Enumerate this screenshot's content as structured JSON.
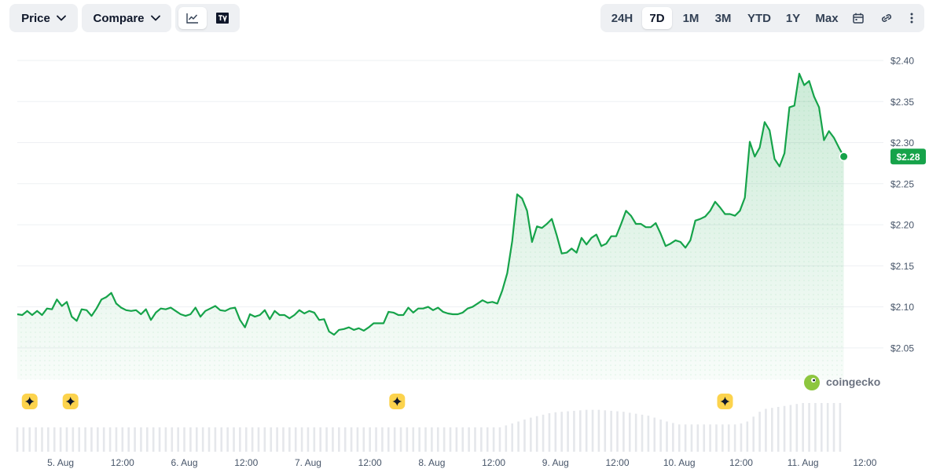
{
  "toolbar": {
    "price_label": "Price",
    "compare_label": "Compare",
    "ranges": [
      "24H",
      "7D",
      "1M",
      "3M",
      "YTD",
      "1Y",
      "Max"
    ],
    "active_range": "7D"
  },
  "watermark": "coingecko",
  "colors": {
    "line": "#16a34a",
    "badge": "#16a34a",
    "grid": "#eef0f3",
    "volume": "#e5e7eb",
    "event": "#fcd34d"
  },
  "icons": [
    "chevron-down-icon",
    "line-chart-icon",
    "tradingview-icon",
    "calendar-icon",
    "link-icon",
    "more-vertical-icon",
    "star-event-icon"
  ],
  "chart_data": {
    "type": "area",
    "y_ticks": [
      "$2.40",
      "$2.35",
      "$2.30",
      "$2.25",
      "$2.20",
      "$2.15",
      "$2.10",
      "$2.05"
    ],
    "y_tick_values": [
      2.4,
      2.35,
      2.3,
      2.25,
      2.2,
      2.15,
      2.1,
      2.05
    ],
    "ylim": [
      2.0116,
      2.4067
    ],
    "xlim": [
      0,
      7.0
    ],
    "x_ticks": [
      "5. Aug",
      "12:00",
      "6. Aug",
      "12:00",
      "7. Aug",
      "12:00",
      "8. Aug",
      "12:00",
      "9. Aug",
      "12:00",
      "10. Aug",
      "12:00",
      "11. Aug",
      "12:00"
    ],
    "x_tick_values": [
      0.35,
      0.85,
      1.35,
      1.85,
      2.35,
      2.85,
      3.35,
      3.85,
      4.35,
      4.85,
      5.35,
      5.85,
      6.35,
      6.85
    ],
    "current_price_label": "$2.28",
    "grid": true,
    "series": [
      {
        "values": [
          [
            0.0,
            2.091
          ],
          [
            0.04,
            2.09
          ],
          [
            0.08,
            2.095
          ],
          [
            0.12,
            2.09
          ],
          [
            0.16,
            2.095
          ],
          [
            0.2,
            2.09
          ],
          [
            0.24,
            2.098
          ],
          [
            0.28,
            2.097
          ],
          [
            0.32,
            2.109
          ],
          [
            0.36,
            2.101
          ],
          [
            0.4,
            2.106
          ],
          [
            0.44,
            2.088
          ],
          [
            0.48,
            2.083
          ],
          [
            0.52,
            2.097
          ],
          [
            0.56,
            2.096
          ],
          [
            0.6,
            2.089
          ],
          [
            0.64,
            2.098
          ],
          [
            0.68,
            2.109
          ],
          [
            0.72,
            2.112
          ],
          [
            0.76,
            2.117
          ],
          [
            0.8,
            2.104
          ],
          [
            0.84,
            2.099
          ],
          [
            0.88,
            2.096
          ],
          [
            0.92,
            2.095
          ],
          [
            0.96,
            2.096
          ],
          [
            1.0,
            2.091
          ],
          [
            1.04,
            2.097
          ],
          [
            1.08,
            2.084
          ],
          [
            1.12,
            2.093
          ],
          [
            1.16,
            2.098
          ],
          [
            1.2,
            2.097
          ],
          [
            1.24,
            2.099
          ],
          [
            1.28,
            2.095
          ],
          [
            1.32,
            2.091
          ],
          [
            1.36,
            2.089
          ],
          [
            1.4,
            2.091
          ],
          [
            1.44,
            2.099
          ],
          [
            1.48,
            2.088
          ],
          [
            1.52,
            2.095
          ],
          [
            1.56,
            2.098
          ],
          [
            1.6,
            2.101
          ],
          [
            1.64,
            2.096
          ],
          [
            1.68,
            2.095
          ],
          [
            1.72,
            2.098
          ],
          [
            1.76,
            2.099
          ],
          [
            1.8,
            2.084
          ],
          [
            1.84,
            2.075
          ],
          [
            1.88,
            2.091
          ],
          [
            1.92,
            2.088
          ],
          [
            1.96,
            2.09
          ],
          [
            2.0,
            2.096
          ],
          [
            2.04,
            2.085
          ],
          [
            2.08,
            2.095
          ],
          [
            2.12,
            2.09
          ],
          [
            2.16,
            2.09
          ],
          [
            2.2,
            2.086
          ],
          [
            2.24,
            2.09
          ],
          [
            2.28,
            2.096
          ],
          [
            2.32,
            2.092
          ],
          [
            2.36,
            2.095
          ],
          [
            2.4,
            2.093
          ],
          [
            2.44,
            2.084
          ],
          [
            2.48,
            2.085
          ],
          [
            2.52,
            2.07
          ],
          [
            2.56,
            2.066
          ],
          [
            2.6,
            2.072
          ],
          [
            2.64,
            2.073
          ],
          [
            2.68,
            2.075
          ],
          [
            2.72,
            2.072
          ],
          [
            2.76,
            2.074
          ],
          [
            2.8,
            2.071
          ],
          [
            2.84,
            2.075
          ],
          [
            2.88,
            2.08
          ],
          [
            2.92,
            2.08
          ],
          [
            2.96,
            2.08
          ],
          [
            3.0,
            2.094
          ],
          [
            3.04,
            2.093
          ],
          [
            3.08,
            2.09
          ],
          [
            3.12,
            2.09
          ],
          [
            3.16,
            2.099
          ],
          [
            3.2,
            2.093
          ],
          [
            3.24,
            2.098
          ],
          [
            3.28,
            2.098
          ],
          [
            3.32,
            2.1
          ],
          [
            3.36,
            2.096
          ],
          [
            3.4,
            2.099
          ],
          [
            3.44,
            2.094
          ],
          [
            3.48,
            2.092
          ],
          [
            3.52,
            2.091
          ],
          [
            3.56,
            2.091
          ],
          [
            3.6,
            2.093
          ],
          [
            3.64,
            2.098
          ],
          [
            3.68,
            2.1
          ],
          [
            3.72,
            2.104
          ],
          [
            3.76,
            2.108
          ],
          [
            3.8,
            2.105
          ],
          [
            3.84,
            2.106
          ],
          [
            3.88,
            2.104
          ],
          [
            3.92,
            2.12
          ],
          [
            3.96,
            2.141
          ],
          [
            4.0,
            2.18
          ],
          [
            4.04,
            2.237
          ],
          [
            4.08,
            2.232
          ],
          [
            4.12,
            2.217
          ],
          [
            4.16,
            2.179
          ],
          [
            4.2,
            2.198
          ],
          [
            4.24,
            2.196
          ],
          [
            4.28,
            2.201
          ],
          [
            4.32,
            2.207
          ],
          [
            4.36,
            2.187
          ],
          [
            4.4,
            2.165
          ],
          [
            4.44,
            2.166
          ],
          [
            4.48,
            2.171
          ],
          [
            4.52,
            2.166
          ],
          [
            4.56,
            2.184
          ],
          [
            4.6,
            2.176
          ],
          [
            4.64,
            2.184
          ],
          [
            4.68,
            2.188
          ],
          [
            4.72,
            2.174
          ],
          [
            4.76,
            2.177
          ],
          [
            4.8,
            2.186
          ],
          [
            4.84,
            2.186
          ],
          [
            4.88,
            2.201
          ],
          [
            4.92,
            2.217
          ],
          [
            4.96,
            2.211
          ],
          [
            5.0,
            2.201
          ],
          [
            5.04,
            2.201
          ],
          [
            5.08,
            2.197
          ],
          [
            5.12,
            2.197
          ],
          [
            5.16,
            2.202
          ],
          [
            5.2,
            2.189
          ],
          [
            5.24,
            2.174
          ],
          [
            5.28,
            2.177
          ],
          [
            5.32,
            2.181
          ],
          [
            5.36,
            2.179
          ],
          [
            5.4,
            2.172
          ],
          [
            5.44,
            2.181
          ],
          [
            5.48,
            2.205
          ],
          [
            5.52,
            2.207
          ],
          [
            5.56,
            2.21
          ],
          [
            5.6,
            2.217
          ],
          [
            5.64,
            2.228
          ],
          [
            5.68,
            2.221
          ],
          [
            5.72,
            2.213
          ],
          [
            5.76,
            2.213
          ],
          [
            5.8,
            2.211
          ],
          [
            5.84,
            2.217
          ],
          [
            5.88,
            2.233
          ],
          [
            5.92,
            2.301
          ],
          [
            5.96,
            2.283
          ],
          [
            6.0,
            2.294
          ],
          [
            6.04,
            2.325
          ],
          [
            6.08,
            2.315
          ],
          [
            6.12,
            2.28
          ],
          [
            6.16,
            2.271
          ],
          [
            6.2,
            2.287
          ],
          [
            6.24,
            2.343
          ],
          [
            6.28,
            2.345
          ],
          [
            6.32,
            2.384
          ],
          [
            6.36,
            2.37
          ],
          [
            6.4,
            2.375
          ],
          [
            6.44,
            2.356
          ],
          [
            6.48,
            2.343
          ],
          [
            6.52,
            2.303
          ],
          [
            6.56,
            2.314
          ],
          [
            6.6,
            2.306
          ],
          [
            6.64,
            2.294
          ],
          [
            6.68,
            2.283
          ]
        ]
      }
    ],
    "volume": [
      [
        0.0,
        0.5
      ],
      [
        0.05,
        0.5
      ],
      [
        0.1,
        0.5
      ],
      [
        0.15,
        0.5
      ],
      [
        0.2,
        0.5
      ],
      [
        0.25,
        0.5
      ],
      [
        0.3,
        0.5
      ],
      [
        0.35,
        0.5
      ],
      [
        0.4,
        0.5
      ],
      [
        0.45,
        0.5
      ],
      [
        0.5,
        0.5
      ],
      [
        0.55,
        0.5
      ],
      [
        0.6,
        0.5
      ],
      [
        0.65,
        0.5
      ],
      [
        0.7,
        0.5
      ],
      [
        0.75,
        0.5
      ],
      [
        0.8,
        0.5
      ],
      [
        0.85,
        0.5
      ],
      [
        0.9,
        0.5
      ],
      [
        0.95,
        0.5
      ],
      [
        1.0,
        0.5
      ],
      [
        1.05,
        0.5
      ],
      [
        1.1,
        0.5
      ],
      [
        1.15,
        0.5
      ],
      [
        1.2,
        0.5
      ],
      [
        1.25,
        0.5
      ],
      [
        1.3,
        0.5
      ],
      [
        1.35,
        0.5
      ],
      [
        1.4,
        0.5
      ],
      [
        1.45,
        0.5
      ],
      [
        1.5,
        0.5
      ],
      [
        1.55,
        0.5
      ],
      [
        1.6,
        0.5
      ],
      [
        1.65,
        0.5
      ],
      [
        1.7,
        0.5
      ],
      [
        1.75,
        0.5
      ],
      [
        1.8,
        0.5
      ],
      [
        1.85,
        0.5
      ],
      [
        1.9,
        0.5
      ],
      [
        1.95,
        0.5
      ],
      [
        2.0,
        0.5
      ],
      [
        2.05,
        0.5
      ],
      [
        2.1,
        0.5
      ],
      [
        2.15,
        0.5
      ],
      [
        2.2,
        0.5
      ],
      [
        2.25,
        0.5
      ],
      [
        2.3,
        0.5
      ],
      [
        2.35,
        0.5
      ],
      [
        2.4,
        0.5
      ],
      [
        2.45,
        0.5
      ],
      [
        2.5,
        0.5
      ],
      [
        2.55,
        0.5
      ],
      [
        2.6,
        0.5
      ],
      [
        2.65,
        0.5
      ],
      [
        2.7,
        0.5
      ],
      [
        2.75,
        0.5
      ],
      [
        2.8,
        0.5
      ],
      [
        2.85,
        0.5
      ],
      [
        2.9,
        0.5
      ],
      [
        2.95,
        0.5
      ],
      [
        3.0,
        0.5
      ],
      [
        3.05,
        0.5
      ],
      [
        3.1,
        0.5
      ],
      [
        3.15,
        0.5
      ],
      [
        3.2,
        0.5
      ],
      [
        3.25,
        0.5
      ],
      [
        3.3,
        0.5
      ],
      [
        3.35,
        0.5
      ],
      [
        3.4,
        0.5
      ],
      [
        3.45,
        0.5
      ],
      [
        3.5,
        0.5
      ],
      [
        3.55,
        0.5
      ],
      [
        3.6,
        0.5
      ],
      [
        3.65,
        0.5
      ],
      [
        3.7,
        0.5
      ],
      [
        3.75,
        0.5
      ],
      [
        3.8,
        0.5
      ],
      [
        3.85,
        0.5
      ],
      [
        3.9,
        0.5
      ],
      [
        3.95,
        0.54
      ],
      [
        4.0,
        0.58
      ],
      [
        4.05,
        0.62
      ],
      [
        4.1,
        0.66
      ],
      [
        4.15,
        0.7
      ],
      [
        4.2,
        0.73
      ],
      [
        4.25,
        0.76
      ],
      [
        4.3,
        0.79
      ],
      [
        4.35,
        0.81
      ],
      [
        4.4,
        0.82
      ],
      [
        4.45,
        0.83
      ],
      [
        4.5,
        0.84
      ],
      [
        4.55,
        0.85
      ],
      [
        4.6,
        0.86
      ],
      [
        4.65,
        0.86
      ],
      [
        4.7,
        0.86
      ],
      [
        4.75,
        0.85
      ],
      [
        4.8,
        0.84
      ],
      [
        4.85,
        0.83
      ],
      [
        4.9,
        0.82
      ],
      [
        4.95,
        0.8
      ],
      [
        5.0,
        0.78
      ],
      [
        5.05,
        0.76
      ],
      [
        5.1,
        0.74
      ],
      [
        5.15,
        0.7
      ],
      [
        5.2,
        0.66
      ],
      [
        5.25,
        0.62
      ],
      [
        5.3,
        0.59
      ],
      [
        5.35,
        0.56
      ],
      [
        5.4,
        0.56
      ],
      [
        5.45,
        0.56
      ],
      [
        5.5,
        0.56
      ],
      [
        5.55,
        0.56
      ],
      [
        5.6,
        0.56
      ],
      [
        5.65,
        0.56
      ],
      [
        5.7,
        0.56
      ],
      [
        5.75,
        0.56
      ],
      [
        5.8,
        0.56
      ],
      [
        5.85,
        0.58
      ],
      [
        5.9,
        0.62
      ],
      [
        5.95,
        0.72
      ],
      [
        6.0,
        0.82
      ],
      [
        6.05,
        0.88
      ],
      [
        6.1,
        0.9
      ],
      [
        6.15,
        0.92
      ],
      [
        6.2,
        0.94
      ],
      [
        6.25,
        0.96
      ],
      [
        6.3,
        0.98
      ],
      [
        6.35,
        1.0
      ],
      [
        6.4,
        1.0
      ],
      [
        6.45,
        1.0
      ],
      [
        6.5,
        1.0
      ],
      [
        6.55,
        1.0
      ],
      [
        6.6,
        1.0
      ],
      [
        6.65,
        1.0
      ]
    ],
    "events": [
      0.1,
      0.43,
      3.07,
      5.72
    ]
  }
}
